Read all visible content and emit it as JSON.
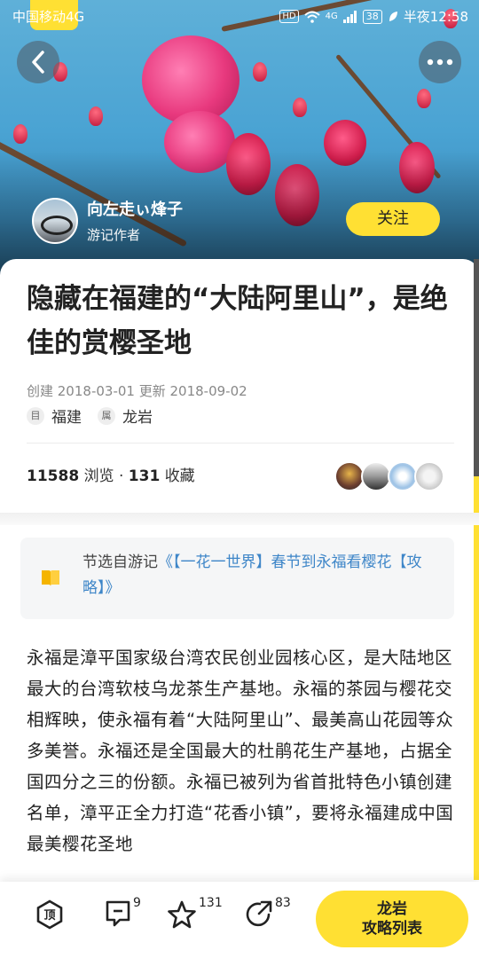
{
  "status_bar": {
    "carrier": "中国移动4G",
    "hd": "HD",
    "network": "4G",
    "battery": "38",
    "time": "半夜12:58"
  },
  "hero": {
    "author_name": "向左走ぃ烽子",
    "author_role": "游记作者",
    "follow_label": "关注"
  },
  "article": {
    "title": "隐藏在福建的“大陆阿里山”，是绝佳的赏樱圣地",
    "dates": "创建 2018-03-01 更新 2018-09-02",
    "tags": [
      {
        "icon_text": "目",
        "label": "福建"
      },
      {
        "icon_text": "属",
        "label": "龙岩"
      }
    ],
    "views": "11588",
    "views_label": "浏览",
    "separator": "·",
    "favorites": "131",
    "favorites_label": "收藏"
  },
  "excerpt": {
    "prefix": "节选自游记",
    "link": "《【一花一世界】春节到永福看樱花【攻略】》"
  },
  "body_text": "永福是漳平国家级台湾农民创业园核心区，是大陆地区最大的台湾软枝乌龙茶生产基地。永福的茶园与樱花交相辉映，使永福有着“大陆阿里山”、最美高山花园等众多美誉。永福还是全国最大的杜鹃花生产基地，占据全国四分之三的份额。永福已被列为省首批特色小镇创建名单，漳平正全力打造“花香小镇”，要将永福建成中国最美樱花圣地",
  "bottom_bar": {
    "top_label": "顶",
    "comment_count": "9",
    "star_count": "131",
    "share_count": "83",
    "cta_line1": "龙岩",
    "cta_line2": "攻略列表"
  },
  "colors": {
    "accent_yellow": "#ffe033",
    "link_blue": "#3e86c8"
  }
}
